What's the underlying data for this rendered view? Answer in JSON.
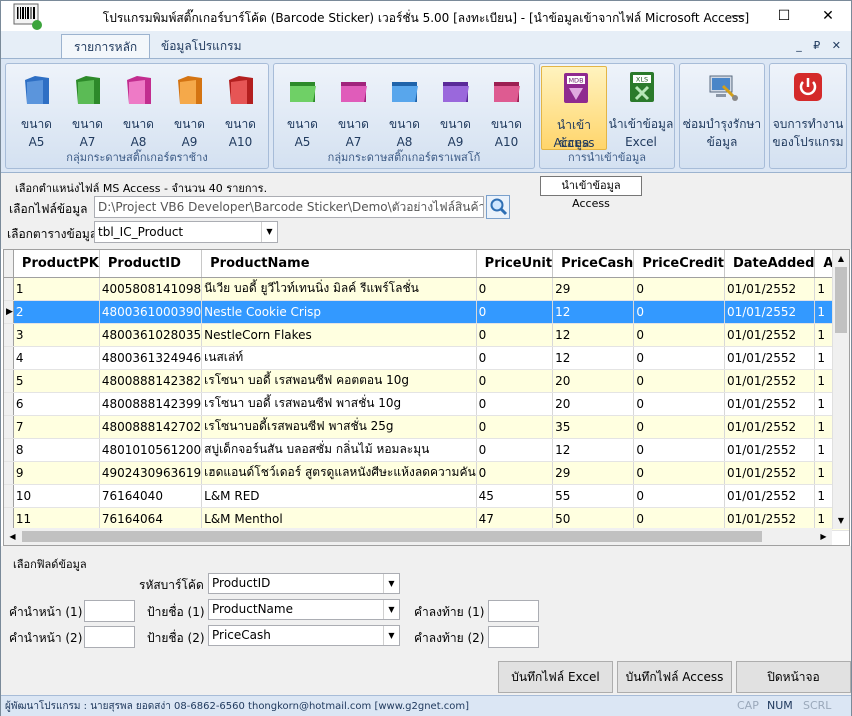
{
  "window": {
    "title": "โปรแกรมพิมพ์สติ๊กเกอร์บาร์โค้ด (Barcode Sticker) เวอร์ชั่น 5.00 [ลงทะเบียน] - [นำข้อมูลเข้าจากไฟล์ Microsoft Access]",
    "minimize": "—",
    "maximize": "☐",
    "close": "✕",
    "mdi_controls": "_ ₽ ✕"
  },
  "ribbon": {
    "tabs": [
      {
        "label": "รายการหลัก"
      },
      {
        "label": "ข้อมูลโปรแกรม"
      }
    ],
    "groups": [
      {
        "label": "กลุ่มกระดาษสติ๊กเกอร์ตราช้าง",
        "buttons": [
          {
            "line1": "ขนาด",
            "line2": "A5",
            "color": "#2e6fc4"
          },
          {
            "line1": "ขนาด",
            "line2": "A7",
            "color": "#3fa63a"
          },
          {
            "line1": "ขนาด",
            "line2": "A8",
            "color": "#e04aa8"
          },
          {
            "line1": "ขนาด",
            "line2": "A9",
            "color": "#ef8f1c"
          },
          {
            "line1": "ขนาด",
            "line2": "A10",
            "color": "#d43333"
          }
        ]
      },
      {
        "label": "กลุ่มกระดาษสติ๊กเกอร์ตราเพสโก้",
        "buttons": [
          {
            "line1": "ขนาด",
            "line2": "A5",
            "color": "#3fa63a"
          },
          {
            "line1": "ขนาด",
            "line2": "A7",
            "color": "#c93a9c"
          },
          {
            "line1": "ขนาด",
            "line2": "A8",
            "color": "#2e88d6"
          },
          {
            "line1": "ขนาด",
            "line2": "A9",
            "color": "#7a3fc2"
          },
          {
            "line1": "ขนาด",
            "line2": "A10",
            "color": "#c2366e"
          }
        ]
      },
      {
        "label": "การนำเข้าข้อมูล",
        "buttons": [
          {
            "line1": "นำเข้าข้อมูล",
            "line2": "Access",
            "icon_text": "MDB"
          },
          {
            "line1": "นำเข้าข้อมูล",
            "line2": "Excel",
            "icon_text": "XLS"
          }
        ]
      },
      {
        "label": "",
        "buttons": [
          {
            "line1": "ซ่อมบำรุงรักษา",
            "line2": "ข้อมูล"
          }
        ]
      },
      {
        "label": "",
        "buttons": [
          {
            "line1": "จบการทำงาน",
            "line2": "ของโปรแกรม"
          }
        ]
      }
    ],
    "tooltip": "นำเข้าข้อมูล Access"
  },
  "file_section": {
    "caption": "เลือกตำแหน่งไฟล์ MS Access - จำนวน 40 รายการ.",
    "file_label": "เลือกไฟล์ข้อมูล",
    "file_path": "D:\\Project VB6 Developer\\Barcode Sticker\\Demo\\ตัวอย่างไฟล์สินค้า.mdb",
    "table_label": "เลือกตารางข้อมูล",
    "table_value": "tbl_IC_Product"
  },
  "grid": {
    "columns": [
      "ProductPK",
      "ProductID",
      "ProductName",
      "PriceUnit",
      "PriceCash",
      "PriceCredit",
      "DateAdded",
      "Adde"
    ],
    "selected_row_marker": "▶",
    "rows": [
      [
        "1",
        "4005808141098",
        "นีเวีย บอดี้ ยูวีไวท์เทนนิ่ง มิลค์ รีแพร์โลชั่น",
        "0",
        "29",
        "0",
        "01/01/2552",
        "1"
      ],
      [
        "2",
        "4800361000390",
        "Nestle Cookie Crisp",
        "0",
        "12",
        "0",
        "01/01/2552",
        "1"
      ],
      [
        "3",
        "4800361028035",
        "NestleCorn Flakes",
        "0",
        "12",
        "0",
        "01/01/2552",
        "1"
      ],
      [
        "4",
        "4800361324946",
        "เนสเล่ท์",
        "0",
        "12",
        "0",
        "01/01/2552",
        "1"
      ],
      [
        "5",
        "4800888142382",
        "เรโซนา บอดี้ เรสพอนซีฟ คอตตอน 10g",
        "0",
        "20",
        "0",
        "01/01/2552",
        "1"
      ],
      [
        "6",
        "4800888142399",
        "เรโซนา บอดี้ เรสพอนซีฟ พาสชั่น 10g",
        "0",
        "20",
        "0",
        "01/01/2552",
        "1"
      ],
      [
        "7",
        "4800888142702",
        "เรโซนาบอดี้เรสพอนซีฟ พาสชั่น 25g",
        "0",
        "35",
        "0",
        "01/01/2552",
        "1"
      ],
      [
        "8",
        "4801010561200",
        "สบู่เด็กจอร์นสัน บลอสซั่ม กลิ่นไม้ หอมละมุน",
        "0",
        "12",
        "0",
        "01/01/2552",
        "1"
      ],
      [
        "9",
        "4902430963619",
        "เฮดแอนด์โชว์เดอร์ สูตรดูแลหนังศีษะแห้งลดความคัน",
        "0",
        "29",
        "0",
        "01/01/2552",
        "1"
      ],
      [
        "10",
        "76164040",
        "L&M RED",
        "45",
        "55",
        "0",
        "01/01/2552",
        "1"
      ],
      [
        "11",
        "76164064",
        "L&M Menthol",
        "47",
        "50",
        "0",
        "01/01/2552",
        "1"
      ]
    ]
  },
  "fields": {
    "caption": "เลือกฟิลด์ข้อมูล",
    "barcode_label": "รหัสบาร์โค้ด",
    "barcode_value": "ProductID",
    "prefix1_label": "คำนำหน้า (1)",
    "prefix2_label": "คำนำหน้า (2)",
    "name1_label": "ป้ายชื่อ (1)",
    "name1_value": "ProductName",
    "name2_label": "ป้ายชื่อ (2)",
    "name2_value": "PriceCash",
    "suffix1_label": "คำลงท้าย (1)",
    "suffix2_label": "คำลงท้าย (2)"
  },
  "buttons": {
    "save_excel": "บันทึกไฟล์ Excel",
    "save_access": "บันทึกไฟล์ Access",
    "close": "ปิดหน้าจอ"
  },
  "statusbar": {
    "text": "ผู้พัฒนาโปรแกรม : นายสุรพล ยอดสง่า 08-6862-6560 thongkorn@hotmail.com [www.g2gnet.com]",
    "cap": "CAP",
    "num": "NUM",
    "scrl": "SCRL"
  }
}
